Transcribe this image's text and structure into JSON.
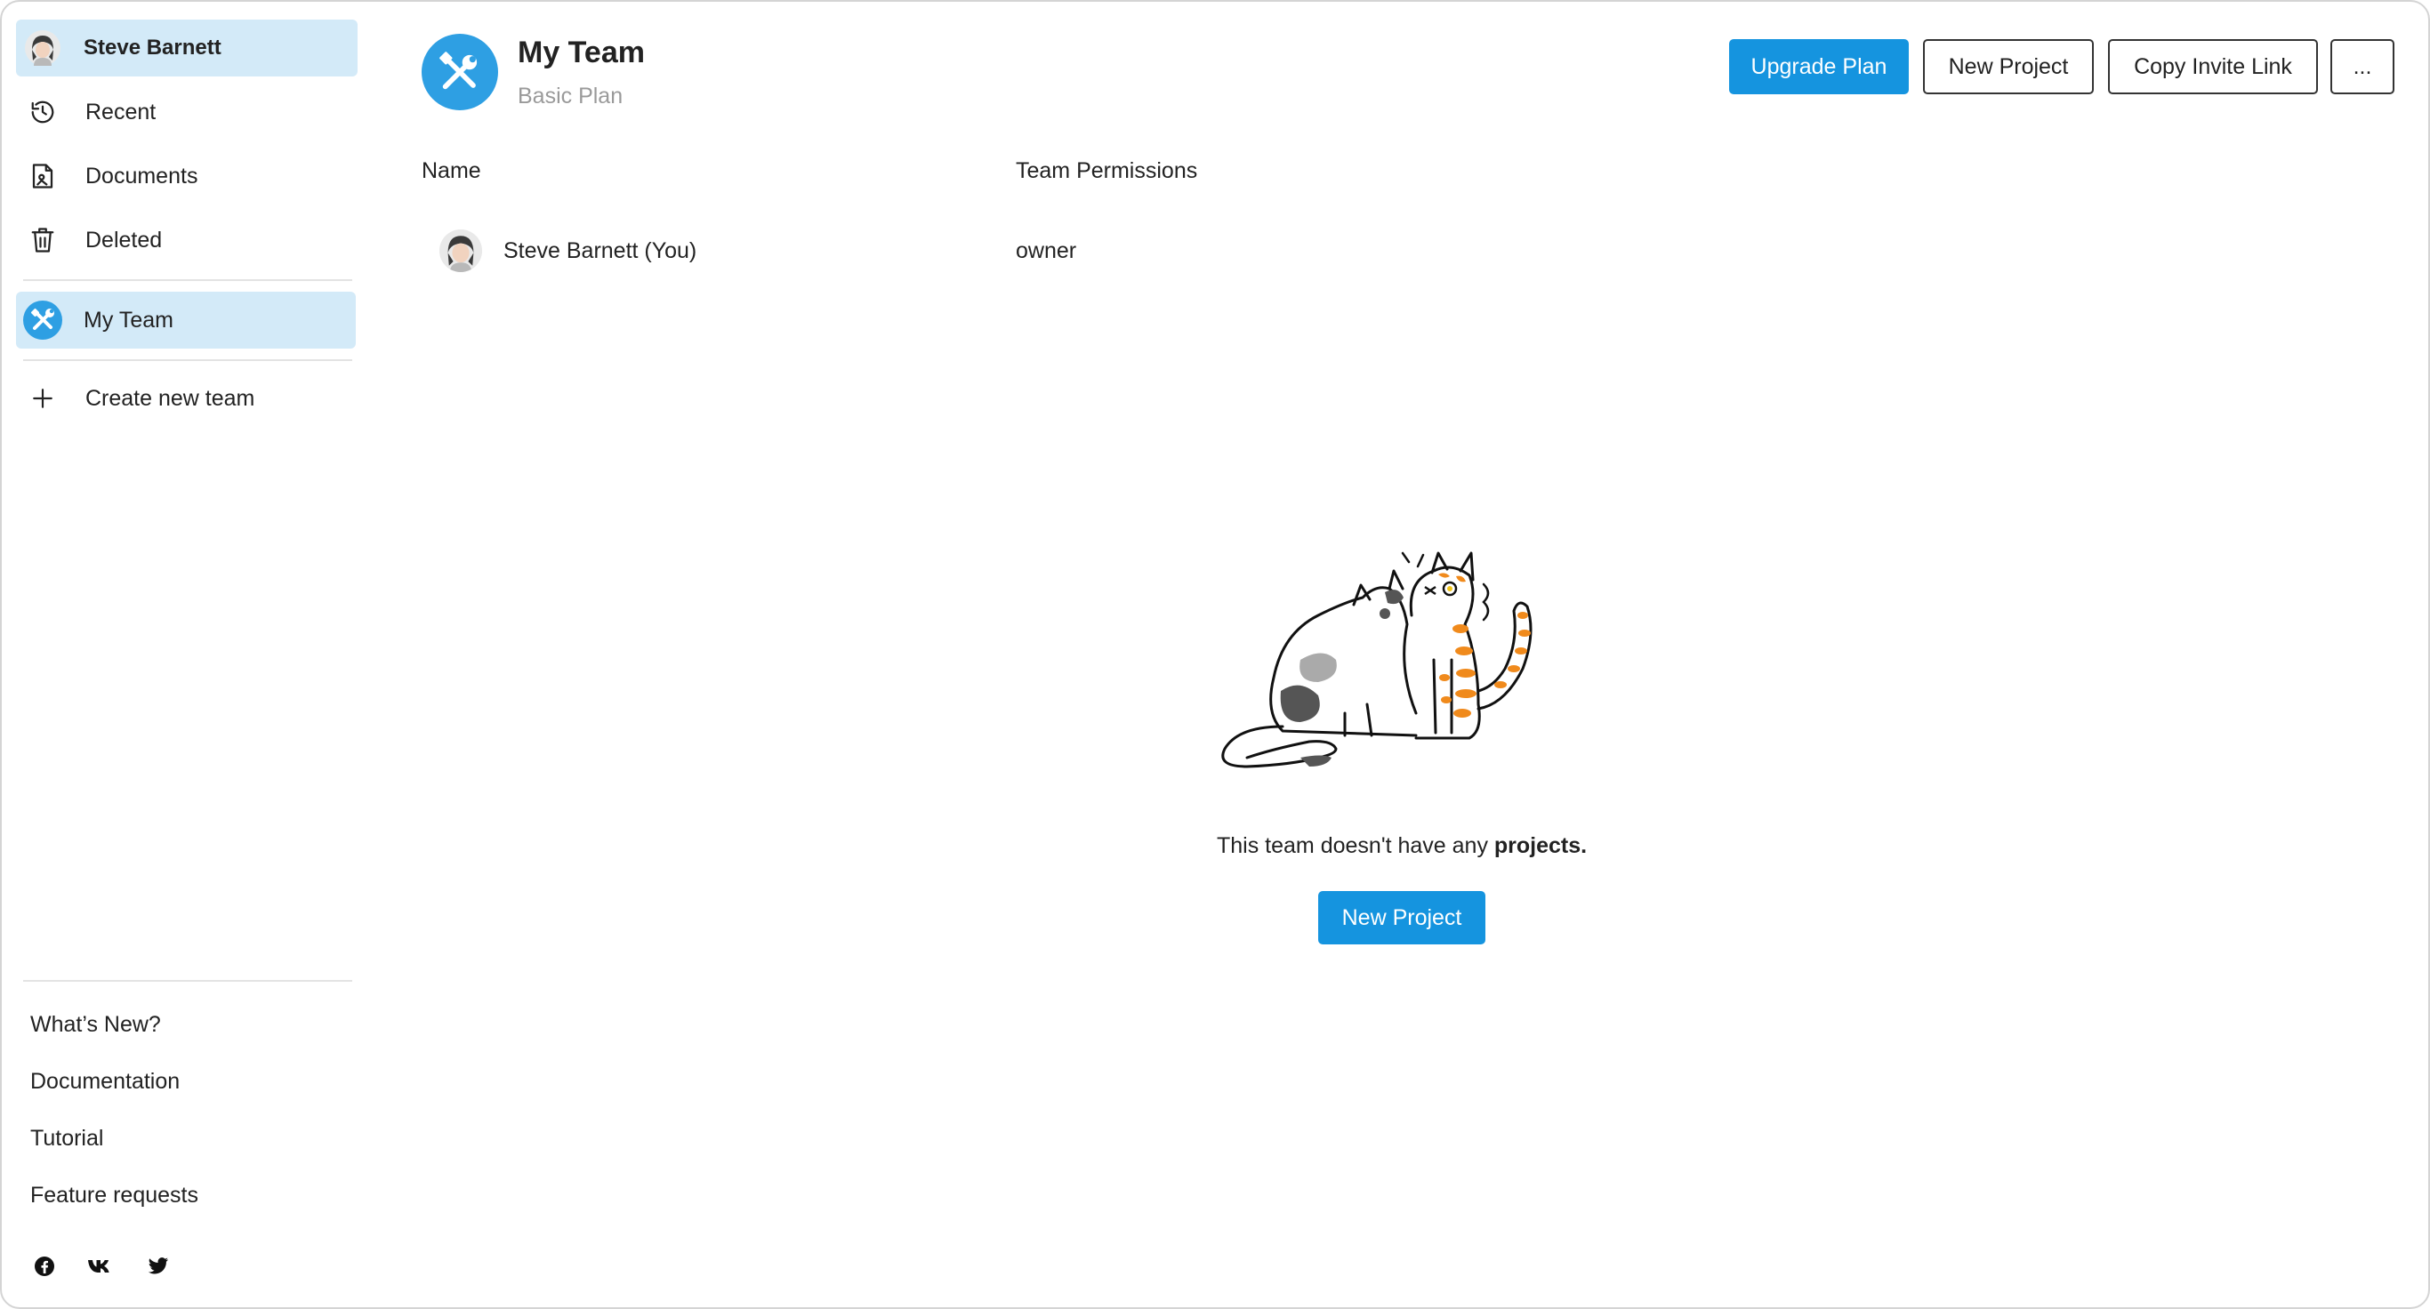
{
  "user": {
    "name": "Steve Barnett"
  },
  "nav": {
    "recent": "Recent",
    "documents": "Documents",
    "deleted": "Deleted",
    "team": "My Team",
    "create_team": "Create new team"
  },
  "footer": {
    "whats_new": "What’s New?",
    "documentation": "Documentation",
    "tutorial": "Tutorial",
    "feature_requests": "Feature requests"
  },
  "social": [
    "facebook-icon",
    "vk-icon",
    "twitter-icon"
  ],
  "header": {
    "title": "My Team",
    "plan": "Basic Plan",
    "upgrade": "Upgrade Plan",
    "new_project": "New Project",
    "copy_invite": "Copy Invite Link",
    "more": "..."
  },
  "table": {
    "columns": [
      "Name",
      "Team Permissions"
    ],
    "rows": [
      {
        "name": "Steve Barnett (You)",
        "permission": "owner"
      }
    ]
  },
  "empty": {
    "text_prefix": "This team doesn't have any ",
    "text_bold": "projects.",
    "button": "New Project"
  },
  "colors": {
    "accent": "#1594df",
    "active_bg": "#d3eaf8",
    "team_logo": "#2e9fe3",
    "cat_stripe": "#f08a1c"
  }
}
